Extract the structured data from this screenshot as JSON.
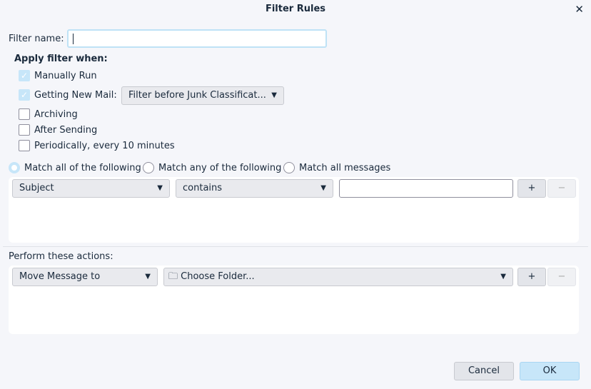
{
  "title": "Filter Rules",
  "filter_name": {
    "label": "Filter name:",
    "value": ""
  },
  "apply": {
    "heading": "Apply filter when:",
    "manual": {
      "label": "Manually Run",
      "checked": true
    },
    "new_mail": {
      "label": "Getting New Mail:",
      "checked": true,
      "option": "Filter before Junk Classificat..."
    },
    "archiving": {
      "label": "Archiving",
      "checked": false
    },
    "after_sending": {
      "label": "After Sending",
      "checked": false
    },
    "periodic": {
      "label": "Periodically, every 10 minutes",
      "checked": false
    }
  },
  "match": {
    "all": "Match all of the following",
    "any": "Match any of the following",
    "all_messages": "Match all messages",
    "selected": "all"
  },
  "rule": {
    "field": "Subject",
    "operator": "contains",
    "value": "",
    "add": "+",
    "remove": "−"
  },
  "actions": {
    "label": "Perform these actions:",
    "action": "Move Message to",
    "folder": "Choose Folder...",
    "add": "+",
    "remove": "−"
  },
  "buttons": {
    "cancel": "Cancel",
    "ok": "OK"
  }
}
